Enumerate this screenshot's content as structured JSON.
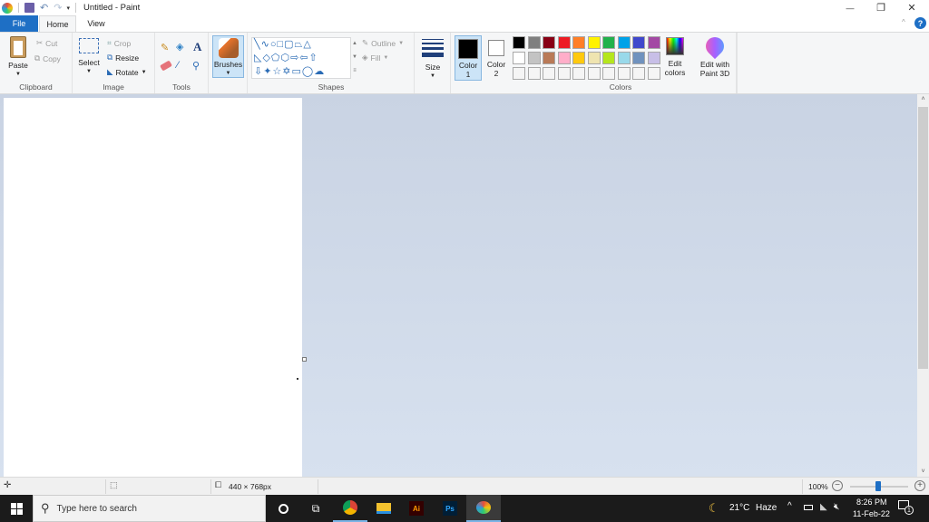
{
  "window": {
    "title": "Untitled - Paint",
    "minimize": "—",
    "restore": "❐",
    "close": "✕"
  },
  "tabs": [
    {
      "label": "File"
    },
    {
      "label": "Home"
    },
    {
      "label": "View"
    }
  ],
  "ribbon": {
    "clipboard": {
      "label": "Clipboard",
      "paste": "Paste",
      "cut": "Cut",
      "copy": "Copy"
    },
    "image": {
      "label": "Image",
      "select": "Select",
      "crop": "Crop",
      "resize": "Resize",
      "rotate": "Rotate"
    },
    "tools": {
      "label": "Tools"
    },
    "brushes": {
      "label": "Brushes"
    },
    "shapes": {
      "label": "Shapes",
      "outline": "Outline",
      "fill": "Fill"
    },
    "size": {
      "label": "Size"
    },
    "colors": {
      "label": "Colors",
      "color1_line1": "Color",
      "color1_line2": "1",
      "color2_line1": "Color",
      "color2_line2": "2",
      "color1_value": "#000000",
      "color2_value": "#ffffff",
      "edit_colors_line1": "Edit",
      "edit_colors_line2": "colors",
      "palette_row1": [
        "#000000",
        "#7f7f7f",
        "#880015",
        "#ed1c24",
        "#ff7f27",
        "#fff200",
        "#22b14c",
        "#00a2e8",
        "#3f48cc",
        "#a349a4"
      ],
      "palette_row2": [
        "#ffffff",
        "#c3c3c3",
        "#b97a57",
        "#ffaec9",
        "#ffc90e",
        "#efe4b0",
        "#b5e61d",
        "#99d9ea",
        "#7092be",
        "#c8bfe7"
      ],
      "palette_row3": [
        "#f5f5f5",
        "#f5f5f5",
        "#f5f5f5",
        "#f5f5f5",
        "#f5f5f5",
        "#f5f5f5",
        "#f5f5f5",
        "#f5f5f5",
        "#f5f5f5",
        "#f5f5f5"
      ]
    },
    "paint3d": {
      "line1": "Edit with",
      "line2": "Paint 3D"
    }
  },
  "statusbar": {
    "canvas_size": "440 × 768px",
    "zoom": "100%",
    "zoom_level_percent": 100
  },
  "taskbar": {
    "search_placeholder": "Type here to search",
    "weather_temp": "21°C",
    "weather_desc": "Haze",
    "time": "8:26 PM",
    "date": "11-Feb-22",
    "notification_count": "1",
    "apps": [
      "Chrome",
      "File Explorer",
      "Illustrator",
      "Photoshop",
      "Paint"
    ],
    "ai_label": "Ai",
    "ps_label": "Ps"
  }
}
